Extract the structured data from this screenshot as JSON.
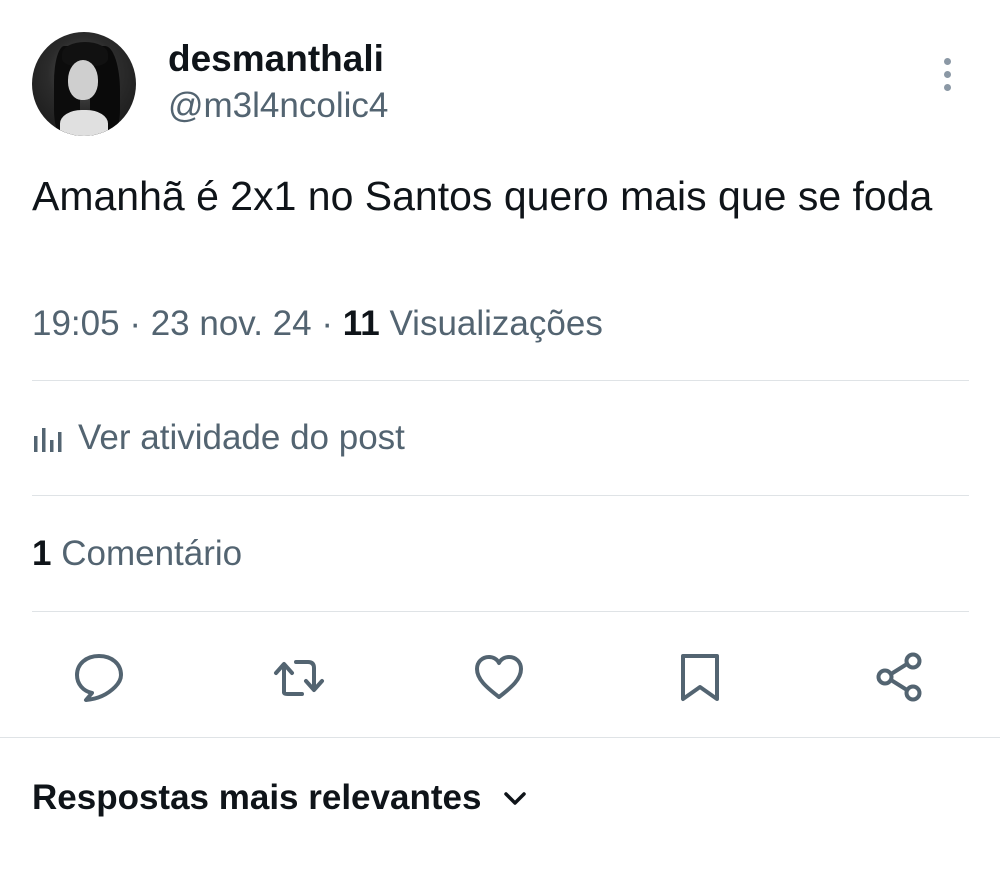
{
  "post": {
    "author": {
      "display_name": "desmanthali",
      "handle": "@m3l4ncolic4"
    },
    "text": "Amanhã é 2x1 no Santos quero mais que se foda",
    "time": "19:05",
    "date": "23 nov. 24",
    "separator": "·",
    "views_count": "11",
    "views_label": "Visualizações"
  },
  "activity": {
    "icon": "analytics-bars-icon",
    "label": "Ver atividade do post"
  },
  "comments": {
    "count": "1",
    "label": "Comentário"
  },
  "actions": [
    {
      "name": "reply",
      "icon": "reply-bubble-icon"
    },
    {
      "name": "repost",
      "icon": "repost-arrows-icon"
    },
    {
      "name": "like",
      "icon": "heart-icon"
    },
    {
      "name": "bookmark",
      "icon": "bookmark-icon"
    },
    {
      "name": "share",
      "icon": "share-nodes-icon"
    }
  ],
  "replies": {
    "sort_label": "Respostas mais relevantes",
    "icon": "chevron-down-icon"
  },
  "colors": {
    "primary_text": "#0f1419",
    "secondary_text": "#536471",
    "divider": "#dfe3e6",
    "more_dots": "#8b98a5"
  }
}
